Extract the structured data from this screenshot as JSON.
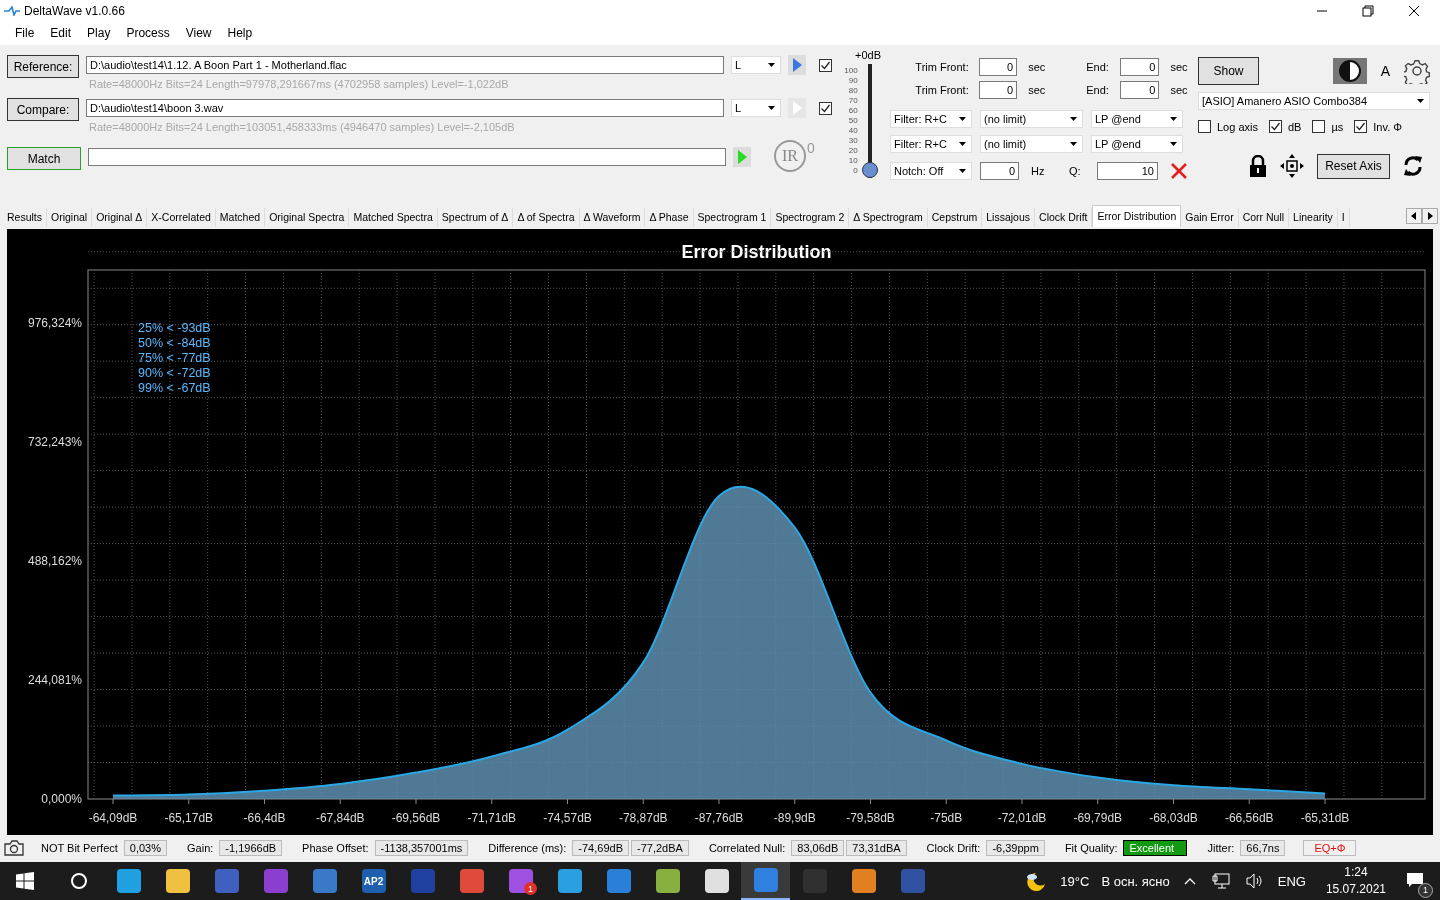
{
  "window": {
    "title": "DeltaWave v1.0.66"
  },
  "menu": [
    "File",
    "Edit",
    "Play",
    "Process",
    "View",
    "Help"
  ],
  "files": [
    {
      "button": "Reference:",
      "path": "D:\\audio\\test14\\1.12. A Boon Part 1 - Motherland.flac",
      "info": "Rate=48000Hz Bits=24 Length=97978,291667ms (4702958 samples) Level=-1,022dB",
      "channel": "L",
      "play_enabled": true,
      "checked": true
    },
    {
      "button": "Compare:",
      "path": "D:\\audio\\test14\\boon 3.wav",
      "info": "Rate=48000Hz Bits=24 Length=103051,458333ms (4946470 samples) Level=-2,105dB",
      "channel": "L",
      "play_enabled": false,
      "checked": true
    }
  ],
  "match": {
    "button": "Match",
    "ir_label": "IR",
    "ir_count": "0"
  },
  "volume": {
    "label": "+0dB",
    "scale": [
      "100",
      "90",
      "80",
      "70",
      "60",
      "50",
      "40",
      "30",
      "20",
      "10",
      "0"
    ],
    "level": 0
  },
  "trim": [
    {
      "label": "Trim Front:",
      "value": "0",
      "unit": "sec",
      "end_label": "End:",
      "end_value": "0",
      "end_unit": "sec"
    },
    {
      "label": "Trim Front:",
      "value": "0",
      "unit": "sec",
      "end_label": "End:",
      "end_value": "0",
      "end_unit": "sec"
    }
  ],
  "filters": [
    {
      "filter": "Filter: R+C",
      "limit": "(no limit)",
      "lowpass": "LP @end"
    },
    {
      "filter": "Filter: R+C",
      "limit": "(no limit)",
      "lowpass": "LP @end"
    }
  ],
  "notch": {
    "select": "Notch: Off",
    "hz_value": "0",
    "hz_unit": "Hz",
    "q_label": "Q:",
    "q_value": "10"
  },
  "display": {
    "show_button": "Show",
    "font_button": "A",
    "device": "[ASIO] Amanero ASIO Combo384",
    "reset_button": "Reset Axis",
    "options": [
      {
        "label": "Log axis",
        "checked": false
      },
      {
        "label": "dB",
        "checked": true
      },
      {
        "label": "µs",
        "checked": false
      },
      {
        "label": "Inv. Φ",
        "checked": true
      }
    ]
  },
  "tabs": [
    {
      "label": "Results",
      "selected": false
    },
    {
      "label": "Original",
      "selected": false
    },
    {
      "label": "Original Δ",
      "selected": false
    },
    {
      "label": "X-Correlated",
      "selected": false
    },
    {
      "label": "Matched",
      "selected": false
    },
    {
      "label": "Original Spectra",
      "selected": false
    },
    {
      "label": "Matched Spectra",
      "selected": false
    },
    {
      "label": "Spectrum of Δ",
      "selected": false
    },
    {
      "label": "Δ of Spectra",
      "selected": false
    },
    {
      "label": "Δ Waveform",
      "selected": false
    },
    {
      "label": "Δ Phase",
      "selected": false
    },
    {
      "label": "Spectrogram 1",
      "selected": false
    },
    {
      "label": "Spectrogram 2",
      "selected": false
    },
    {
      "label": "Δ Spectrogram",
      "selected": false
    },
    {
      "label": "Cepstrum",
      "selected": false
    },
    {
      "label": "Lissajous",
      "selected": false
    },
    {
      "label": "Clock Drift",
      "selected": false
    },
    {
      "label": "Error Distribution",
      "selected": true
    },
    {
      "label": "Gain Error",
      "selected": false
    },
    {
      "label": "Corr Null",
      "selected": false
    },
    {
      "label": "Linearity",
      "selected": false
    },
    {
      "label": "I",
      "selected": false
    }
  ],
  "plot": {
    "chart_data": {
      "type": "area",
      "title": "Error Distribution",
      "categories": [
        "-64,09dB",
        "-65,17dB",
        "-66,4dB",
        "-67,84dB",
        "-69,56dB",
        "-71,71dB",
        "-74,57dB",
        "-78,87dB",
        "-87,76dB",
        "-89,9dB",
        "-79,58dB",
        "-75dB",
        "-72,01dB",
        "-69,79dB",
        "-68,03dB",
        "-66,56dB",
        "-65,31dB"
      ],
      "values": [
        7,
        9,
        17,
        31,
        54,
        87,
        142,
        280,
        621,
        556,
        218,
        120,
        72,
        44,
        28,
        20,
        11
      ],
      "ylim": [
        0,
        1084
      ],
      "yticks": [
        {
          "value": 0,
          "label": "0,000%"
        },
        {
          "value": 244.081,
          "label": "244,081%"
        },
        {
          "value": 488.162,
          "label": "488,162%"
        },
        {
          "value": 732.243,
          "label": "732,243%"
        },
        {
          "value": 976.324,
          "label": "976,324%"
        }
      ],
      "annotations": [
        {
          "text": "25% < -93dB"
        },
        {
          "text": "50% < -84dB"
        },
        {
          "text": "75% < -77dB"
        },
        {
          "text": "90% < -72dB"
        },
        {
          "text": "99% < -67dB"
        }
      ]
    }
  },
  "status": [
    {
      "kind": "field",
      "label": "NOT Bit Perfect",
      "values": [
        "0,03%"
      ]
    },
    {
      "kind": "field",
      "label": "Gain:",
      "values": [
        "-1,1966dB"
      ]
    },
    {
      "kind": "field",
      "label": "Phase Offset:",
      "values": [
        "-1138,357001ms"
      ]
    },
    {
      "kind": "field",
      "label": "Difference (ms):",
      "values": [
        "-74,69dB",
        "-77,2dBA"
      ]
    },
    {
      "kind": "field",
      "label": "Correlated Null:",
      "values": [
        "83,06dB",
        "73,31dBA"
      ]
    },
    {
      "kind": "field",
      "label": "Clock Drift:",
      "values": [
        "-6,39ppm"
      ]
    },
    {
      "kind": "quality",
      "label": "Fit Quality:",
      "values": [
        "Excellent"
      ]
    },
    {
      "kind": "field",
      "label": "Jitter:",
      "values": [
        "66,7ns"
      ]
    },
    {
      "kind": "flag",
      "label": "EQ+Φ"
    }
  ],
  "taskbar": {
    "apps": [
      {
        "color": "#1fa0e0",
        "active": false
      },
      {
        "color": "#f0c040",
        "active": false
      },
      {
        "color": "#4060c0",
        "active": false
      },
      {
        "color": "#8a3fd0",
        "active": false
      },
      {
        "color": "#3a78c8",
        "active": false
      },
      {
        "color": "#1e5fb0",
        "active": false,
        "label": "AP2"
      },
      {
        "color": "#2040a0",
        "active": false
      },
      {
        "color": "#e04a3a",
        "active": false
      },
      {
        "color": "#a050e0",
        "active": false,
        "badge": "1"
      },
      {
        "color": "#2aa0e0",
        "active": false
      },
      {
        "color": "#2a7fd8",
        "active": false
      },
      {
        "color": "#88b040",
        "active": false
      },
      {
        "color": "#e0e0e0",
        "active": false
      },
      {
        "color": "#3080e0",
        "active": true
      },
      {
        "color": "#303030",
        "active": false
      },
      {
        "color": "#e08020",
        "active": false
      },
      {
        "color": "#3050a0",
        "active": false
      }
    ],
    "temperature": "19°C",
    "weather": "В осн. ясно",
    "language": "ENG",
    "time": "1:24",
    "date": "15.07.2021",
    "notifications": "1"
  }
}
